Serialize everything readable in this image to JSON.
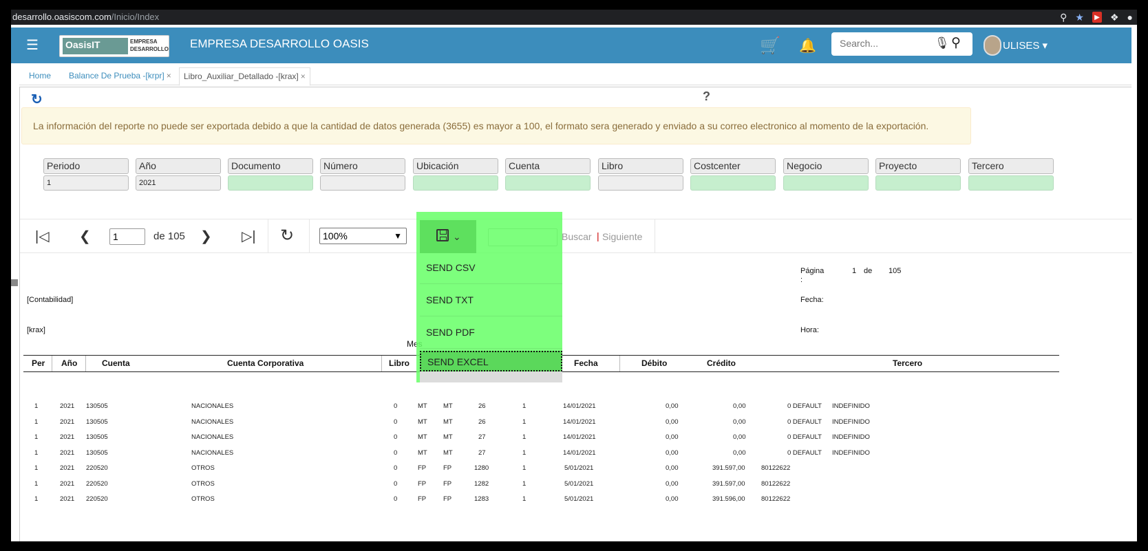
{
  "browser": {
    "host": "desarrollo.oasiscom.com",
    "path": "/Inicio/Index"
  },
  "header": {
    "logo_main": "OasisIT",
    "logo_sub": "EMPRESA DESARROLLO",
    "title": "EMPRESA DESARROLLO OASIS",
    "search_placeholder": "Search...",
    "username": "ULISES"
  },
  "tabs": [
    {
      "label": "Home"
    },
    {
      "label": "Balance De Prueba -[krpr]"
    },
    {
      "label": "Libro_Auxiliar_Detallado -[krax]"
    }
  ],
  "warning": "La información del reporte no puede ser exportada debido a que la cantidad de datos generada (3655) es mayor a 100, el formato sera generado y enviado a su correo electronico al momento de la exportación.",
  "params": [
    {
      "label": "Periodo",
      "value": "1",
      "filled": false
    },
    {
      "label": "Año",
      "value": "2021",
      "filled": false
    },
    {
      "label": "Documento",
      "value": "",
      "filled": true
    },
    {
      "label": "Número",
      "value": "",
      "filled": false
    },
    {
      "label": "Ubicación",
      "value": "",
      "filled": true
    },
    {
      "label": "Cuenta",
      "value": "",
      "filled": true
    },
    {
      "label": "Libro",
      "value": "",
      "filled": false
    },
    {
      "label": "Costcenter",
      "value": "",
      "filled": true
    },
    {
      "label": "Negocio",
      "value": "",
      "filled": true
    },
    {
      "label": "Proyecto",
      "value": "",
      "filled": true
    },
    {
      "label": "Tercero",
      "value": "",
      "filled": true
    }
  ],
  "toolbar": {
    "page_value": "1",
    "of_pages": "de 105",
    "zoom": "100%",
    "find_label": "Buscar",
    "find_sep": "|",
    "next_label": "Siguiente"
  },
  "export_menu": [
    "SEND CSV",
    "SEND TXT",
    "SEND PDF",
    "SEND EXCEL"
  ],
  "report": {
    "pagina_label": "Página",
    "colon": ":",
    "page_num": "1",
    "de": "de",
    "page_total": "105",
    "fecha_label": "Fecha:",
    "hora_label": "Hora:",
    "contabilidad": "[Contabilidad]",
    "krax": "[krax]",
    "mes": "Mes",
    "columns": [
      "Per",
      "Año",
      "Cuenta",
      "Cuenta Corporativa",
      "Libro",
      "Fecha",
      "Débito",
      "Crédito",
      "Tercero"
    ],
    "rows": [
      [
        "1",
        "2021",
        "130505",
        "NACIONALES",
        "0",
        "MT",
        "MT",
        "26",
        "1",
        "14/01/2021",
        "0,00",
        "0,00",
        "0 DEFAULT",
        "INDEFINIDO"
      ],
      [
        "1",
        "2021",
        "130505",
        "NACIONALES",
        "0",
        "MT",
        "MT",
        "26",
        "1",
        "14/01/2021",
        "0,00",
        "0,00",
        "0 DEFAULT",
        "INDEFINIDO"
      ],
      [
        "1",
        "2021",
        "130505",
        "NACIONALES",
        "0",
        "MT",
        "MT",
        "27",
        "1",
        "14/01/2021",
        "0,00",
        "0,00",
        "0 DEFAULT",
        "INDEFINIDO"
      ],
      [
        "1",
        "2021",
        "130505",
        "NACIONALES",
        "0",
        "MT",
        "MT",
        "27",
        "1",
        "14/01/2021",
        "0,00",
        "0,00",
        "0 DEFAULT",
        "INDEFINIDO"
      ],
      [
        "1",
        "2021",
        "220520",
        "OTROS",
        "0",
        "FP",
        "FP",
        "1280",
        "1",
        "5/01/2021",
        "0,00",
        "391.597,00",
        "80122622",
        ""
      ],
      [
        "1",
        "2021",
        "220520",
        "OTROS",
        "0",
        "FP",
        "FP",
        "1282",
        "1",
        "5/01/2021",
        "0,00",
        "391.597,00",
        "80122622",
        ""
      ],
      [
        "1",
        "2021",
        "220520",
        "OTROS",
        "0",
        "FP",
        "FP",
        "1283",
        "1",
        "5/01/2021",
        "0,00",
        "391.596,00",
        "80122622",
        ""
      ]
    ]
  }
}
